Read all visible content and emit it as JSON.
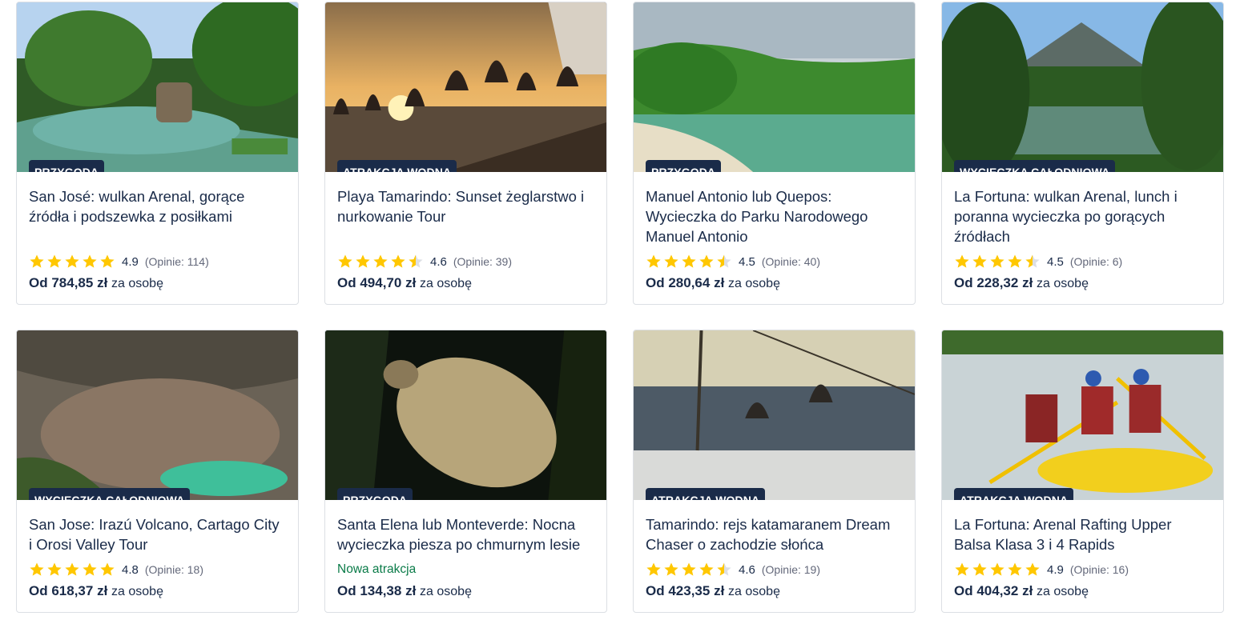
{
  "cards": [
    {
      "category": "PRZYGODA",
      "title": "San José: wulkan Arenal, gorące źródła i podszewka z posiłkami",
      "rating": "4.9",
      "stars": 5,
      "reviews": "(Opinie: 114)",
      "price_prefix": "Od",
      "price": "784,85 zł",
      "per": "za osobę",
      "image_icon": "hot-springs-pool-image"
    },
    {
      "category": "ATRAKCJA WODNA",
      "title": "Playa Tamarindo: Sunset żeglarstwo i nurkowanie Tour",
      "rating": "4.6",
      "stars": 4.5,
      "reviews": "(Opinie: 39)",
      "price_prefix": "Od",
      "price": "494,70 zł",
      "per": "za osobę",
      "image_icon": "sunset-sailing-image"
    },
    {
      "category": "PRZYGODA",
      "title": "Manuel Antonio lub Quepos: Wycieczka do Parku Narodowego Manuel Antonio",
      "rating": "4.5",
      "stars": 4.5,
      "reviews": "(Opinie: 40)",
      "price_prefix": "Od",
      "price": "280,64 zł",
      "per": "za osobę",
      "image_icon": "beach-jungle-image"
    },
    {
      "category": "WYCIECZKA CAŁODNIOWA",
      "title": "La Fortuna: wulkan Arenal, lunch i poranna wycieczka po gorących źródłach",
      "rating": "4.5",
      "stars": 4.5,
      "reviews": "(Opinie: 6)",
      "price_prefix": "Od",
      "price": "228,32 zł",
      "per": "za osobę",
      "image_icon": "volcano-lake-image"
    },
    {
      "category": "WYCIECZKA CAŁODNIOWA",
      "title": "San Jose: Irazú Volcano, Cartago City i Orosi Valley Tour",
      "rating": "4.8",
      "stars": 5,
      "reviews": "(Opinie: 18)",
      "price_prefix": "Od",
      "price": "618,37 zł",
      "per": "za osobę",
      "image_icon": "crater-lake-image"
    },
    {
      "category": "PRZYGODA",
      "title": "Santa Elena lub Monteverde: Nocna wycieczka piesza po chmurnym lesie",
      "new_label": "Nowa atrakcja",
      "price_prefix": "Od",
      "price": "134,38 zł",
      "per": "za osobę",
      "image_icon": "sloth-night-image"
    },
    {
      "category": "ATRAKCJA WODNA",
      "title": "Tamarindo: rejs katamaranem Dream Chaser o zachodzie słońca",
      "rating": "4.6",
      "stars": 4.5,
      "reviews": "(Opinie: 19)",
      "price_prefix": "Od",
      "price": "423,35 zł",
      "per": "za osobę",
      "image_icon": "catamaran-image"
    },
    {
      "category": "ATRAKCJA WODNA",
      "title": "La Fortuna: Arenal Rafting Upper Balsa Klasa 3 i 4 Rapids",
      "rating": "4.9",
      "stars": 5,
      "reviews": "(Opinie: 16)",
      "price_prefix": "Od",
      "price": "404,32 zł",
      "per": "za osobę",
      "image_icon": "rafting-image"
    }
  ],
  "colors": {
    "badge_bg": "#1a2b49",
    "text": "#1a2b49",
    "star": "#ffc700",
    "star_empty": "#dcdfe4",
    "new": "#0a7b48"
  }
}
